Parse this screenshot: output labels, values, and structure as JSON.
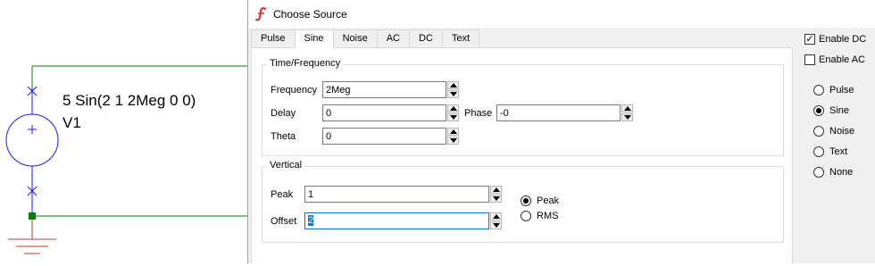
{
  "schematic": {
    "source_value": "5 Sin(2 1 2Meg 0 0)",
    "source_name": "V1"
  },
  "dialog": {
    "title": "Choose Source",
    "tabs": [
      {
        "label": "Pulse",
        "active": false
      },
      {
        "label": "Sine",
        "active": true
      },
      {
        "label": "Noise",
        "active": false
      },
      {
        "label": "AC",
        "active": false
      },
      {
        "label": "DC",
        "active": false
      },
      {
        "label": "Text",
        "active": false
      }
    ],
    "time_frequency": {
      "legend": "Time/Frequency",
      "frequency": {
        "label": "Frequency",
        "value": "2Meg"
      },
      "delay": {
        "label": "Delay",
        "value": "0"
      },
      "phase": {
        "label": "Phase",
        "value": "-0"
      },
      "theta": {
        "label": "Theta",
        "value": "0"
      }
    },
    "vertical": {
      "legend": "Vertical",
      "peak": {
        "label": "Peak",
        "value": "1"
      },
      "offset": {
        "label": "Offset",
        "value": "2"
      },
      "mode_options": [
        {
          "label": "Peak",
          "checked": true
        },
        {
          "label": "RMS",
          "checked": false
        }
      ]
    },
    "enable_dc": {
      "label": "Enable DC",
      "checked": true
    },
    "enable_ac": {
      "label": "Enable AC",
      "checked": false
    },
    "source_types": [
      {
        "label": "Pulse",
        "checked": false
      },
      {
        "label": "Sine",
        "checked": true
      },
      {
        "label": "Noise",
        "checked": false
      },
      {
        "label": "Text",
        "checked": false
      },
      {
        "label": "None",
        "checked": false
      }
    ]
  },
  "colors": {
    "wire": "#008000",
    "component": "#1a1aff",
    "ground": "#c0392b",
    "selection": "#0078d7"
  }
}
